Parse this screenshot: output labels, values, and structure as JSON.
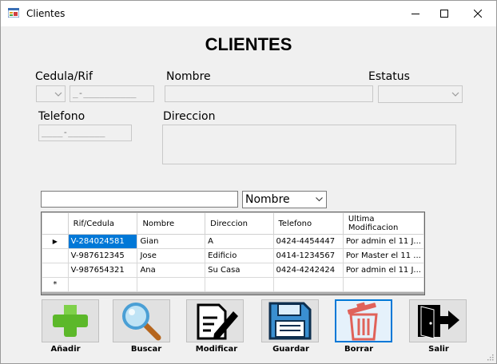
{
  "window": {
    "title": "Clientes"
  },
  "form": {
    "heading": "CLIENTES",
    "labels": {
      "cedula": "Cedula/Rif",
      "nombre": "Nombre",
      "estatus": "Estatus",
      "telefono": "Telefono",
      "direccion": "Direccion"
    },
    "fields": {
      "cedula_mask": "_-__________",
      "telefono_mask": "____-_______"
    }
  },
  "search": {
    "value": "",
    "filter_selected": "Nombre"
  },
  "grid": {
    "columns": [
      "Rif/Cedula",
      "Nombre",
      "Direccion",
      "Telefono",
      "Ultima Modificacion"
    ],
    "rows": [
      [
        "V-284024581",
        "Gian",
        "A",
        "0424-4454447",
        "Por admin el 11 J..."
      ],
      [
        "V-987612345",
        "Jose",
        "Edificio",
        "0414-1234567",
        "Por Master el 11 ..."
      ],
      [
        "V-987654321",
        "Ana",
        "Su Casa",
        "0424-4242424",
        "Por admin el 11 J..."
      ]
    ],
    "current_row_marker": "▶",
    "new_row_marker": "*"
  },
  "toolbar": {
    "add_label": "Añadir",
    "search_label": "Buscar",
    "edit_label": "Modificar",
    "save_label": "Guardar",
    "delete_label": "Borrar",
    "exit_label": "Salir"
  },
  "colors": {
    "selection": "#0078d7",
    "add_green": "#6cbf2a",
    "delete_red": "#d9534f"
  }
}
